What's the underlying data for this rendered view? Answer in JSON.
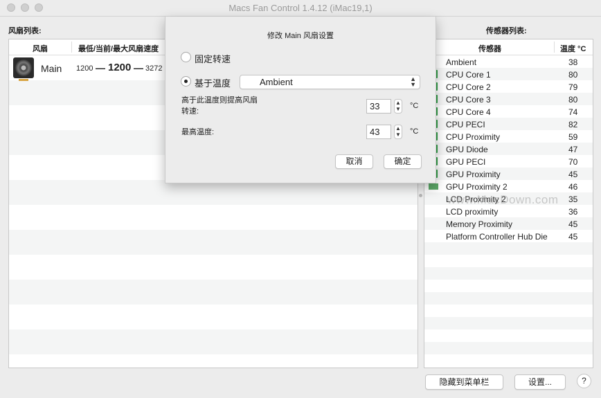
{
  "window": {
    "title": "Macs Fan Control 1.4.12 (iMac19,1)"
  },
  "fans_section": {
    "label": "风扇列表:",
    "col_fan": "风扇",
    "col_speed": "最低/当前/最大风扇速度",
    "fans": [
      {
        "name": "Main",
        "min": "1200",
        "current": "1200",
        "max": "3272",
        "icon": "fan-icon"
      }
    ]
  },
  "sensors_section": {
    "label": "传感器列表:",
    "col_sensor": "传感器",
    "col_temp": "温度 °C",
    "sensors": [
      {
        "name": "Ambient",
        "value": "38"
      },
      {
        "name": "CPU Core 1",
        "value": "80"
      },
      {
        "name": "CPU Core 2",
        "value": "79"
      },
      {
        "name": "CPU Core 3",
        "value": "80"
      },
      {
        "name": "CPU Core 4",
        "value": "74"
      },
      {
        "name": "CPU PECI",
        "value": "82"
      },
      {
        "name": "CPU Proximity",
        "value": "59"
      },
      {
        "name": "GPU Diode",
        "value": "47"
      },
      {
        "name": "GPU PECI",
        "value": "70"
      },
      {
        "name": "GPU Proximity",
        "value": "45"
      },
      {
        "name": "GPU Proximity 2",
        "value": "46"
      },
      {
        "name": "LCD Proximity 2",
        "value": "35"
      },
      {
        "name": "LCD proximity",
        "value": "36"
      },
      {
        "name": "Memory Proximity",
        "value": "45"
      },
      {
        "name": "Platform Controller Hub Die",
        "value": "45"
      }
    ]
  },
  "watermark": "www.MacDown.com",
  "buttons": {
    "hide_to_menubar": "隐藏到菜单栏",
    "settings": "设置...",
    "help": "?"
  },
  "dialog": {
    "title": "修改 Main 风扇设置",
    "fixed_speed_label": "固定转速",
    "temp_based_label": "基于温度",
    "sensor_select_value": "Ambient",
    "raise_label_line1": "高于此温度则提高风扇",
    "raise_label_line2": "转速:",
    "raise_value": "33",
    "max_temp_label": "最高温度:",
    "max_temp_value": "43",
    "unit": "°C",
    "cancel": "取消",
    "ok": "确定"
  }
}
